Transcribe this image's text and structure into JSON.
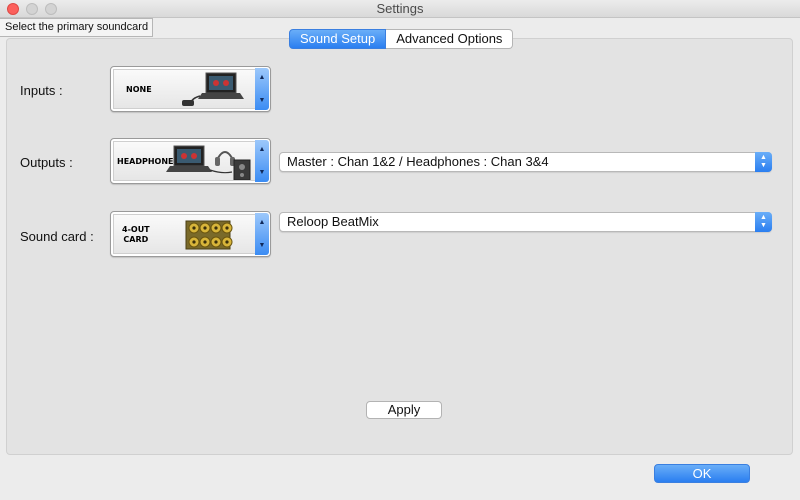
{
  "window": {
    "title": "Settings"
  },
  "tooltip": "Select the primary soundcard",
  "tabs": [
    {
      "label": "Sound Setup",
      "active": true
    },
    {
      "label": "Advanced Options",
      "active": false
    }
  ],
  "inputs": {
    "label": "Inputs :",
    "picker_caption": "NONE"
  },
  "outputs": {
    "label": "Outputs :",
    "picker_caption": "HEADPHONES",
    "select_value": "Master : Chan 1&2 / Headphones : Chan 3&4"
  },
  "soundcard": {
    "label": "Sound card :",
    "picker_caption_line1": "4-OUT",
    "picker_caption_line2": "CARD",
    "select_value": "Reloop BeatMix"
  },
  "buttons": {
    "apply": "Apply",
    "ok": "OK"
  },
  "colors": {
    "accent": "#2a7ef0",
    "close": "#fc605c"
  }
}
